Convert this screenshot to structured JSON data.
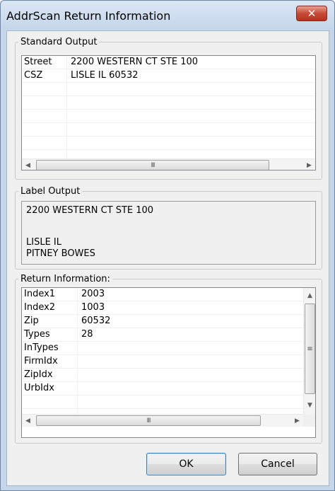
{
  "window": {
    "title": "AddrScan Return Information",
    "close_glyph": "✕"
  },
  "standard_output": {
    "legend": "Standard Output",
    "rows": [
      {
        "field": "Street",
        "value": "2200 WESTERN CT STE 100"
      },
      {
        "field": "CSZ",
        "value": "LISLE IL 60532"
      },
      {
        "field": "",
        "value": ""
      },
      {
        "field": "",
        "value": ""
      },
      {
        "field": "",
        "value": ""
      },
      {
        "field": "",
        "value": ""
      },
      {
        "field": "",
        "value": ""
      }
    ]
  },
  "label_output": {
    "legend": "Label Output",
    "lines": [
      "2200 WESTERN CT STE 100",
      "",
      "LISLE IL",
      "PITNEY BOWES"
    ]
  },
  "return_information": {
    "legend": "Return Information:",
    "rows": [
      {
        "field": "Index1",
        "value": "2003"
      },
      {
        "field": "Index2",
        "value": "1003"
      },
      {
        "field": "Zip",
        "value": "60532"
      },
      {
        "field": "Types",
        "value": "28"
      },
      {
        "field": "InTypes",
        "value": ""
      },
      {
        "field": "FirmIdx",
        "value": ""
      },
      {
        "field": "ZipIdx",
        "value": ""
      },
      {
        "field": "UrbIdx",
        "value": ""
      }
    ]
  },
  "scrollbar": {
    "left_arrow": "◀",
    "right_arrow": "▶",
    "up_arrow": "▲",
    "down_arrow": "▼",
    "grip_h": "III",
    "grip_v": "≡"
  },
  "buttons": {
    "ok": "OK",
    "cancel": "Cancel"
  }
}
